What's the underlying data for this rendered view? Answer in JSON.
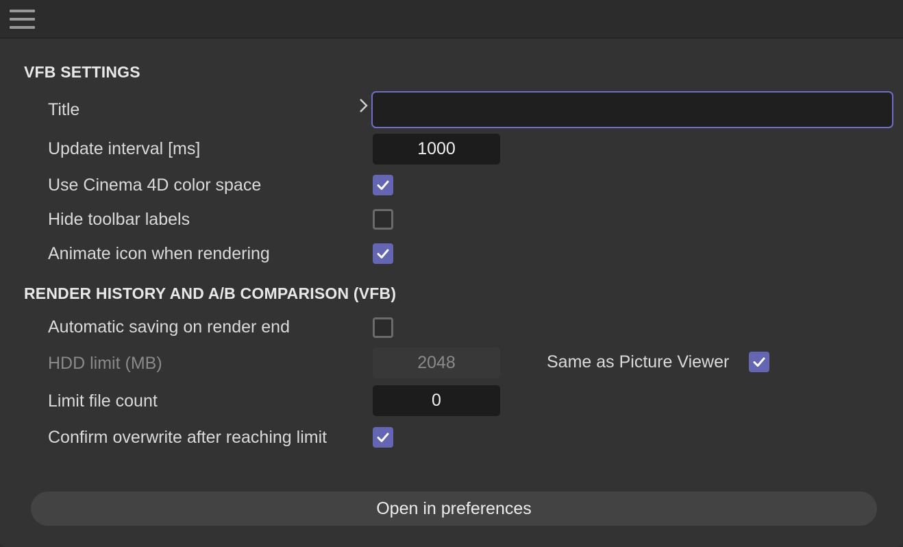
{
  "toolbar": {
    "menu_icon": "hamburger-menu-icon"
  },
  "vfb_settings": {
    "heading": "VFB SETTINGS",
    "title_label": "Title",
    "title_value": "",
    "update_interval_label": "Update interval [ms]",
    "update_interval_value": "1000",
    "use_c4d_color_label": "Use Cinema 4D color space",
    "use_c4d_color_checked": true,
    "hide_toolbar_labels_label": "Hide toolbar labels",
    "hide_toolbar_labels_checked": false,
    "animate_icon_label": "Animate icon when rendering",
    "animate_icon_checked": true
  },
  "render_history": {
    "heading": "RENDER HISTORY AND A/B COMPARISON (VFB)",
    "auto_saving_label": "Automatic saving on render end",
    "auto_saving_checked": false,
    "hdd_limit_label": "HDD limit (MB)",
    "hdd_limit_value": "2048",
    "same_as_pv_label": "Same as Picture Viewer",
    "same_as_pv_checked": true,
    "limit_file_count_label": "Limit file count",
    "limit_file_count_value": "0",
    "confirm_overwrite_label": "Confirm overwrite after reaching limit",
    "confirm_overwrite_checked": true
  },
  "footer": {
    "open_prefs_label": "Open in preferences"
  },
  "colors": {
    "accent": "#6466b4",
    "focus_border": "#6f6fc7",
    "background": "#333333",
    "field_bg": "#1c1c1c"
  }
}
